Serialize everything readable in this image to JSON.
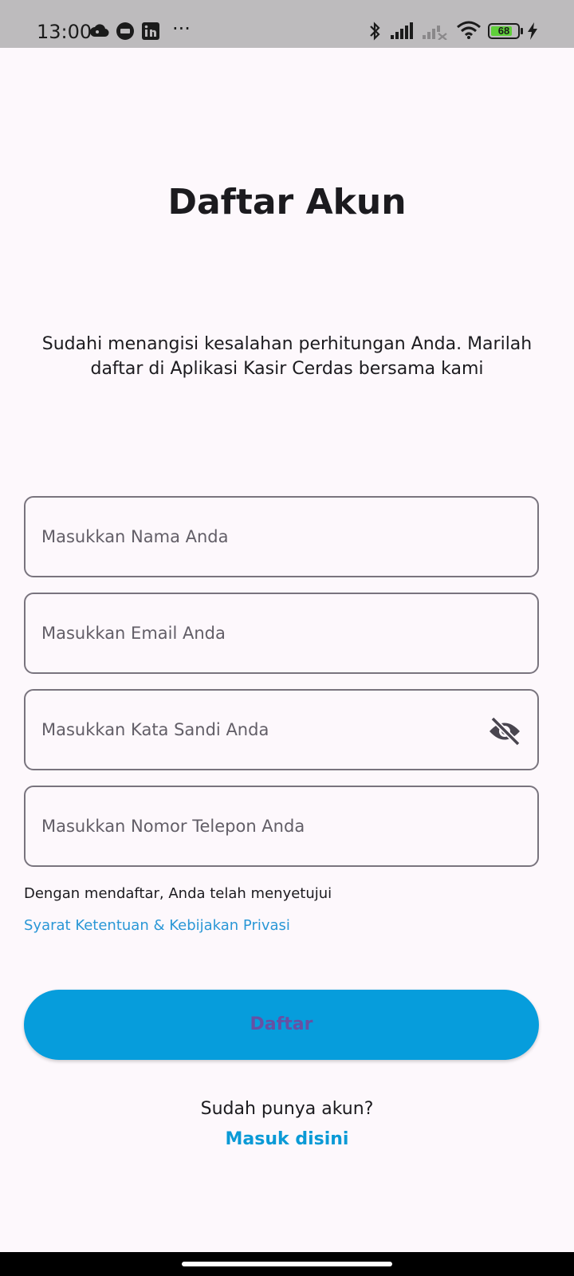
{
  "status_bar": {
    "time": "13:00",
    "ellipsis": "···",
    "battery_level": "68",
    "left_icons": [
      "cloud-icon",
      "chat-bubble-icon",
      "linkedin-icon"
    ],
    "right_icons": [
      "bluetooth-icon",
      "signal-icon",
      "signal-no-service-icon",
      "wifi-icon",
      "battery-icon",
      "charging-bolt-icon"
    ]
  },
  "page": {
    "title": "Daftar Akun",
    "subtitle": "Sudahi menangisi kesalahan perhitungan Anda. Marilah daftar di Aplikasi Kasir Cerdas bersama kami"
  },
  "form": {
    "name_placeholder": "Masukkan Nama Anda",
    "email_placeholder": "Masukkan Email Anda",
    "password_placeholder": "Masukkan Kata Sandi Anda",
    "phone_placeholder": "Masukkan Nomor Telepon Anda",
    "password_visibility_icon": "eye-off-icon"
  },
  "consent": {
    "text": "Dengan mendaftar, Anda telah menyetujui",
    "terms_link": "Syarat Ketentuan & Kebijakan Privasi"
  },
  "actions": {
    "register_label": "Daftar",
    "have_account_text": "Sudah punya akun?",
    "login_link": "Masuk disini"
  },
  "colors": {
    "background": "#fdf8fc",
    "primary_button": "#069ddc",
    "button_text": "#6750a4",
    "link": "#0a9ad6",
    "field_border": "#79747e",
    "status_bar": "#bdbbbd"
  }
}
